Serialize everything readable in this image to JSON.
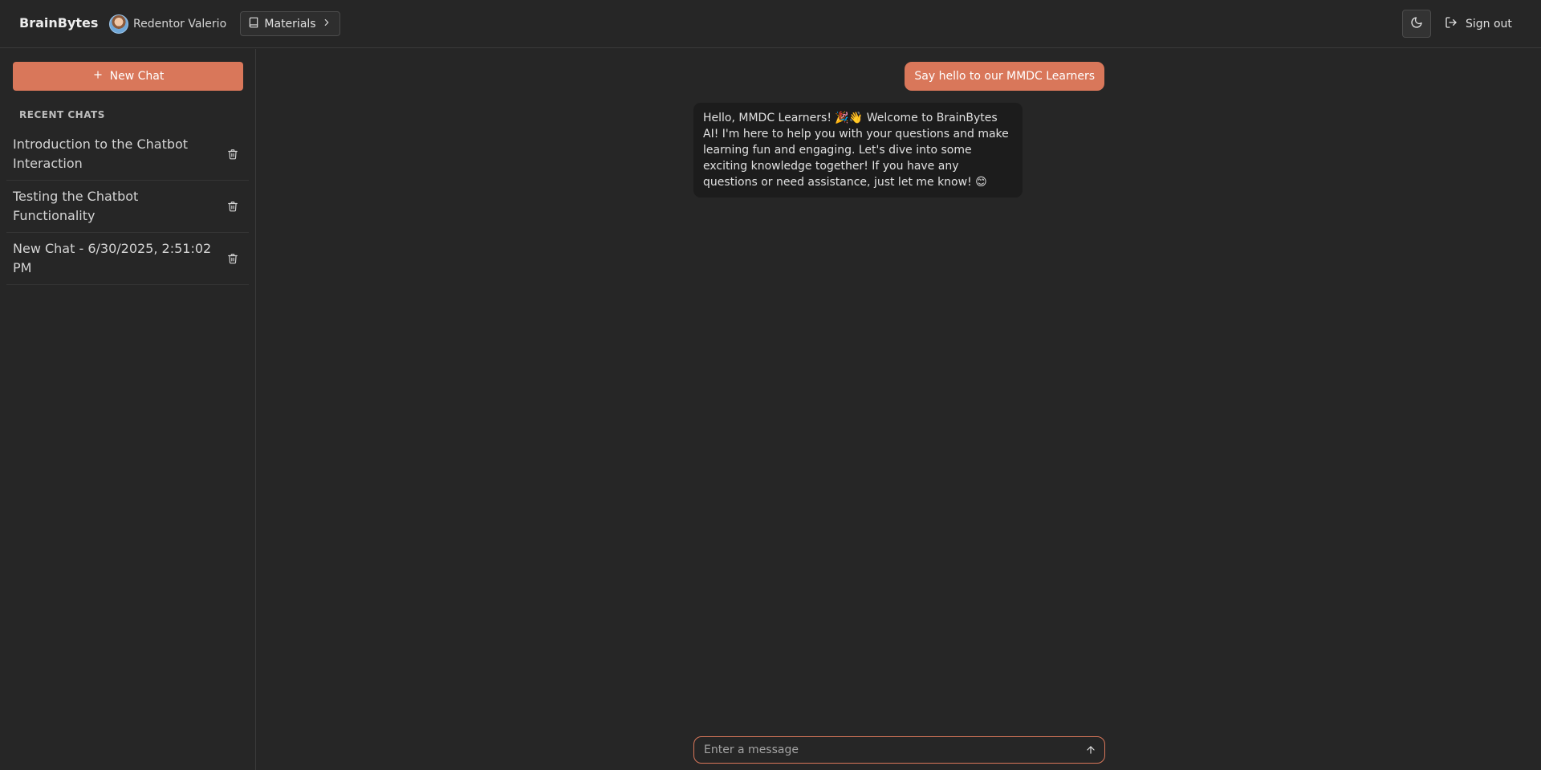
{
  "header": {
    "brand": "BrainBytes",
    "user_name": "Redentor Valerio",
    "materials_label": "Materials",
    "signout_label": "Sign out",
    "theme_icon": "moon-icon"
  },
  "sidebar": {
    "new_chat_label": "New Chat",
    "recent_label": "RECENT CHATS",
    "chats": [
      {
        "title": "Introduction to the Chatbot Interaction"
      },
      {
        "title": "Testing the Chatbot Functionality"
      },
      {
        "title": "New Chat - 6/30/2025, 2:51:02 PM"
      }
    ]
  },
  "conversation": {
    "user_message": "Say hello to our MMDC Learners",
    "ai_message": "Hello, MMDC Learners! 🎉👋 Welcome to BrainBytes AI! I'm here to help you with your questions and make learning fun and engaging. Let's dive into some exciting knowledge together! If you have any questions or need assistance, just let me know! 😊"
  },
  "composer": {
    "placeholder": "Enter a message",
    "value": ""
  },
  "colors": {
    "accent": "#d9775a",
    "background": "#262626",
    "ai_bubble": "#1c1c1c"
  }
}
